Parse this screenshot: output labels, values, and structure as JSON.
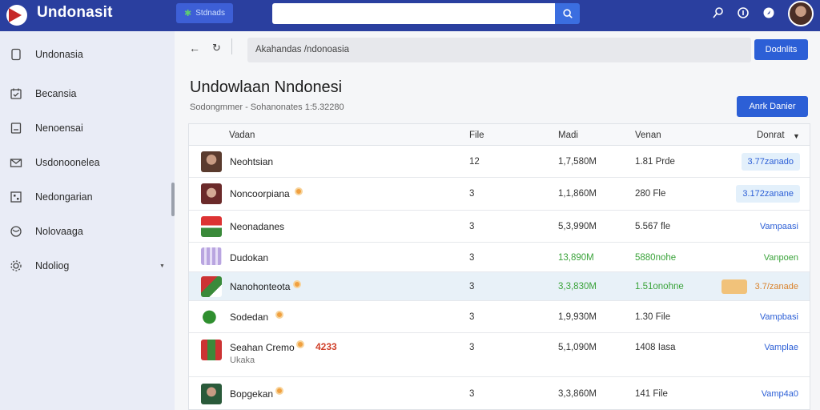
{
  "app": {
    "title": "Undonasit",
    "chip_label": "Stdnads"
  },
  "search": {
    "placeholder": ""
  },
  "sidebar": {
    "items": [
      {
        "label": "Undonasia",
        "icon": "phone-icon"
      },
      {
        "label": "Becansia",
        "icon": "calendar-icon"
      },
      {
        "label": "Nenoensai",
        "icon": "note-icon"
      },
      {
        "label": "Usdonoonelea",
        "icon": "mail-icon"
      },
      {
        "label": "Nedongarian",
        "icon": "grid-icon"
      },
      {
        "label": "Nolovaaga",
        "icon": "globe-icon"
      },
      {
        "label": "Ndoliog",
        "icon": "gear-icon"
      }
    ]
  },
  "address": {
    "value": "Akahandas /ndonoasia"
  },
  "buttons": {
    "top_label": "Dodnlits",
    "primary_label": "Anrk Danier"
  },
  "page": {
    "title": "Undowlaan Nndonesi",
    "subtitle": "Sodongmmer  -  Sohanonates  1:5.32280"
  },
  "table": {
    "headers": {
      "name": "Vadan",
      "file": "File",
      "size": "Madi",
      "version": "Venan",
      "status": "Donrat"
    },
    "rows": [
      {
        "name": "Neohtsian",
        "file": "12",
        "size": "1,7,580M",
        "version": "1.81 Prde",
        "status": "3.77zanado",
        "status_style": "pill"
      },
      {
        "name": "Noncoorpiana",
        "file": "3",
        "size": "1,1,860M",
        "version": "280 Fle",
        "status": "3.172zanane",
        "status_style": "pill",
        "dot": true
      },
      {
        "name": "Neonadanes",
        "file": "3",
        "size": "5,3,990M",
        "version": "5.567 fle",
        "status": "Vampaasi"
      },
      {
        "name": "Dudokan",
        "file": "3",
        "size": "13,890M",
        "version": "5880nohe",
        "status": "Vanpoen",
        "green": true
      },
      {
        "name": "Nanohonteota",
        "file": "3",
        "size": "3,3,830M",
        "version": "1.51onohne",
        "status": "3.7/zanade",
        "status_style": "orange",
        "dot": true,
        "green": true
      },
      {
        "name": "Sodedan",
        "file": "3",
        "size": "1,9,930M",
        "version": "1.30 File",
        "status": "Vampbasi",
        "dot": true
      },
      {
        "name": "Seahan Cremo",
        "sub": "Ukaka",
        "extra": "4233",
        "file": "3",
        "size": "5,1,090M",
        "version": "1408 Iasa",
        "status": "Vamplae",
        "dot": true
      },
      {
        "name": "Bopgekan",
        "file": "3",
        "size": "3,3,860M",
        "version": "141 File",
        "status": "Vamp4a0",
        "dot": true
      }
    ]
  },
  "colors": {
    "topbar": "#2a3f9f",
    "accent": "#2c5fd6",
    "green": "#3aa33a"
  }
}
